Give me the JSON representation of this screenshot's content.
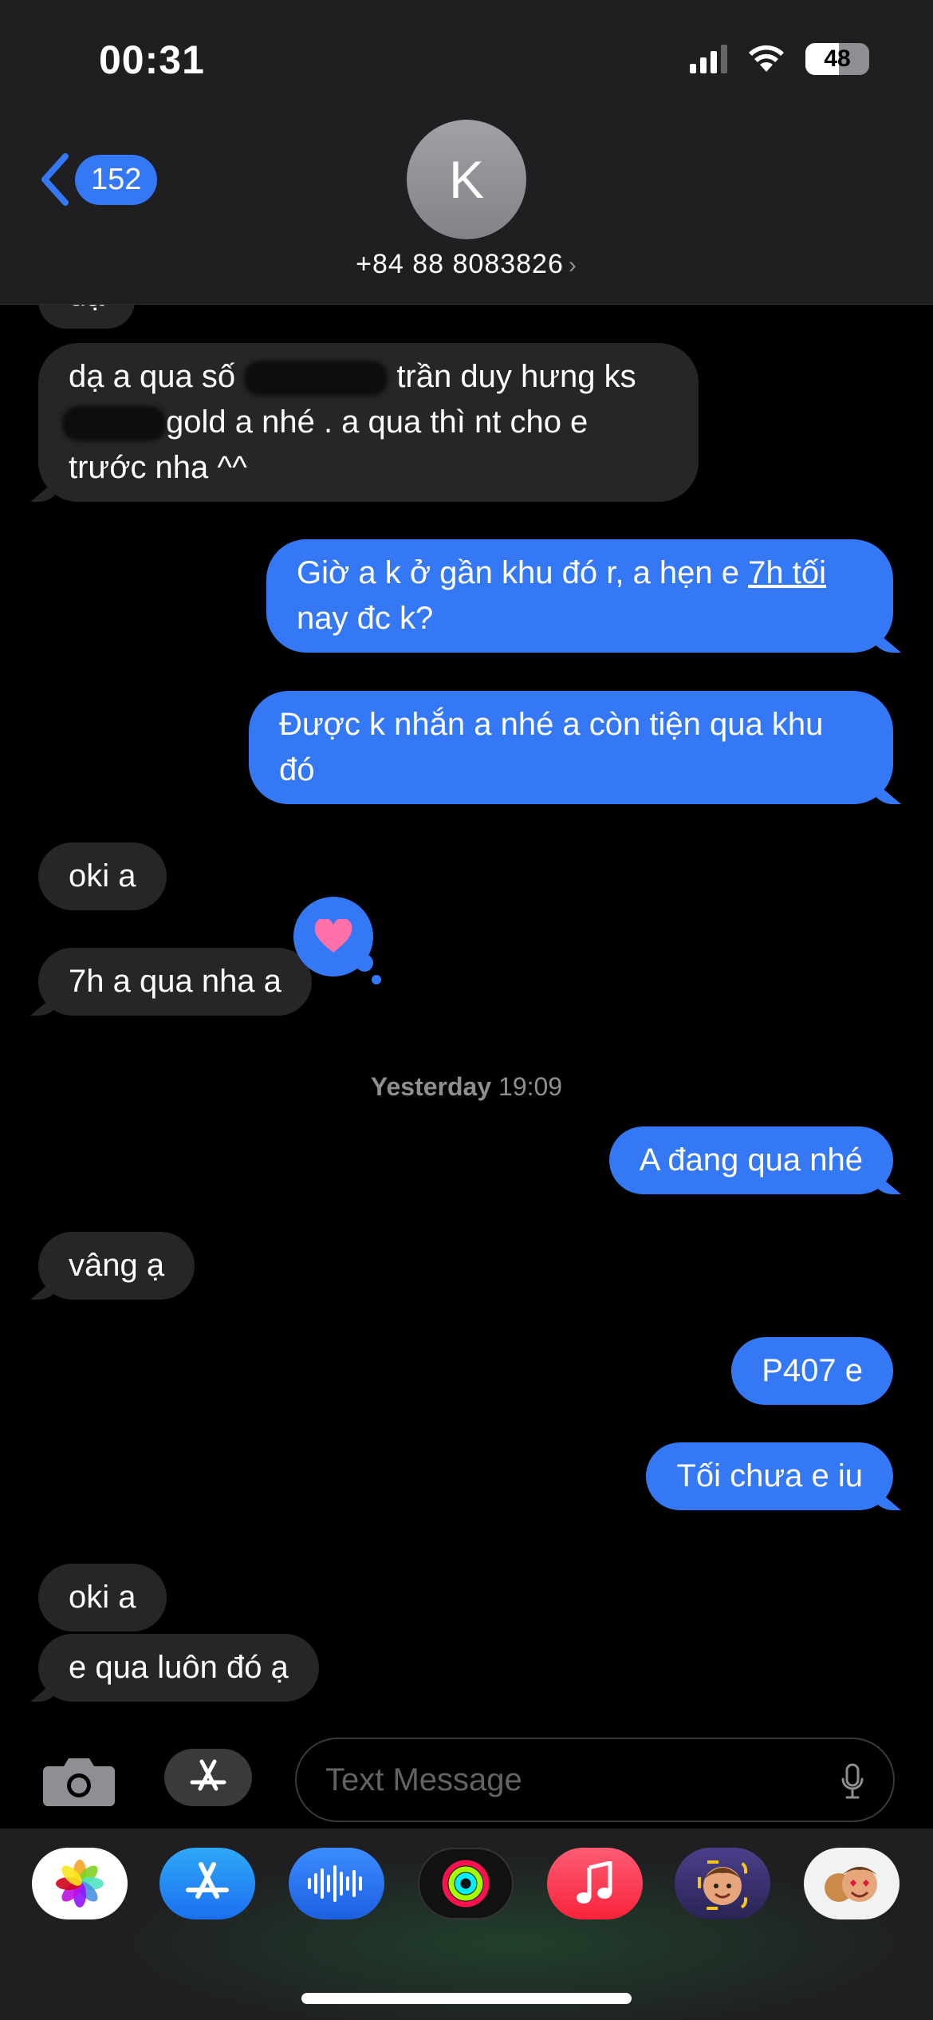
{
  "status_bar": {
    "time": "00:31",
    "battery": "48"
  },
  "header": {
    "back_count": "152",
    "avatar_initial": "K",
    "contact": "+84 88 8083826",
    "chevron": "›"
  },
  "thread": {
    "partial_top": "dạ",
    "m1_part1": "dạ a qua số",
    "m1_part2": "trần duy hưng ks",
    "m1_part3": "gold  a nhé . a qua thì nt cho e",
    "m1_part4": "trước nha ^^",
    "m2_part1": "Giờ a k ở gần khu đó r, a hẹn e ",
    "m2_link": "7h tối",
    "m2_part2": "nay đc k?",
    "m3": "Được k nhắn a nhé a còn tiện qua khu đó",
    "m4": "oki a",
    "m5": "7h a qua nha a",
    "timestamp_day": "Yesterday",
    "timestamp_time": "19:09",
    "m6": "A đang qua nhé",
    "m7": "vâng ạ",
    "m8": "P407 e",
    "m9": "Tối chưa e iu",
    "m10": "oki a",
    "m11": "e qua luôn đó ạ"
  },
  "composer": {
    "placeholder": "Text Message"
  },
  "colors": {
    "outgoing": "#3478f6",
    "incoming": "#262628",
    "background": "#000000"
  },
  "icons": [
    "camera-icon",
    "app-store-icon",
    "microphone-icon",
    "heart-icon",
    "photos-icon",
    "audio-icon",
    "activity-icon",
    "music-icon",
    "memoji-icon"
  ]
}
